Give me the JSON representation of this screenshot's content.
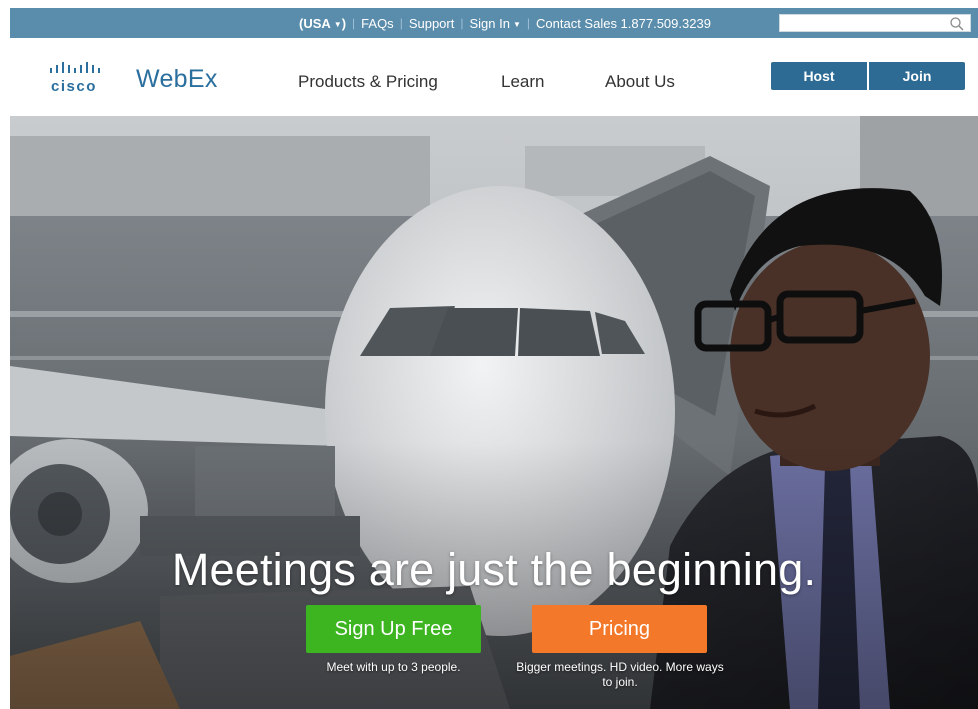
{
  "topbar": {
    "country": "(USA",
    "country_close": ")",
    "faqs": "FAQs",
    "support": "Support",
    "sign_in": "Sign In",
    "contact": "Contact Sales 1.877.509.3239",
    "search_placeholder": ""
  },
  "header": {
    "logo_cisco": "cisco",
    "logo_webex": "WebEx",
    "nav": {
      "products": "Products & Pricing",
      "learn": "Learn",
      "about": "About Us"
    },
    "host_label": "Host",
    "join_label": "Join"
  },
  "hero": {
    "headline": "Meetings are just the beginning.",
    "signup_label": "Sign Up Free",
    "signup_caption": "Meet with up to 3 people.",
    "pricing_label": "Pricing",
    "pricing_caption": "Bigger meetings. HD video. More ways to join."
  },
  "colors": {
    "topbar": "#5a8cab",
    "brand_blue": "#2b6f9e",
    "button_blue": "#2d6b94",
    "signup_green": "#3cb521",
    "pricing_orange": "#f3782a"
  },
  "icons": {
    "search": "search-icon",
    "caret": "chevron-down-icon",
    "logo": "cisco-logo-icon"
  }
}
